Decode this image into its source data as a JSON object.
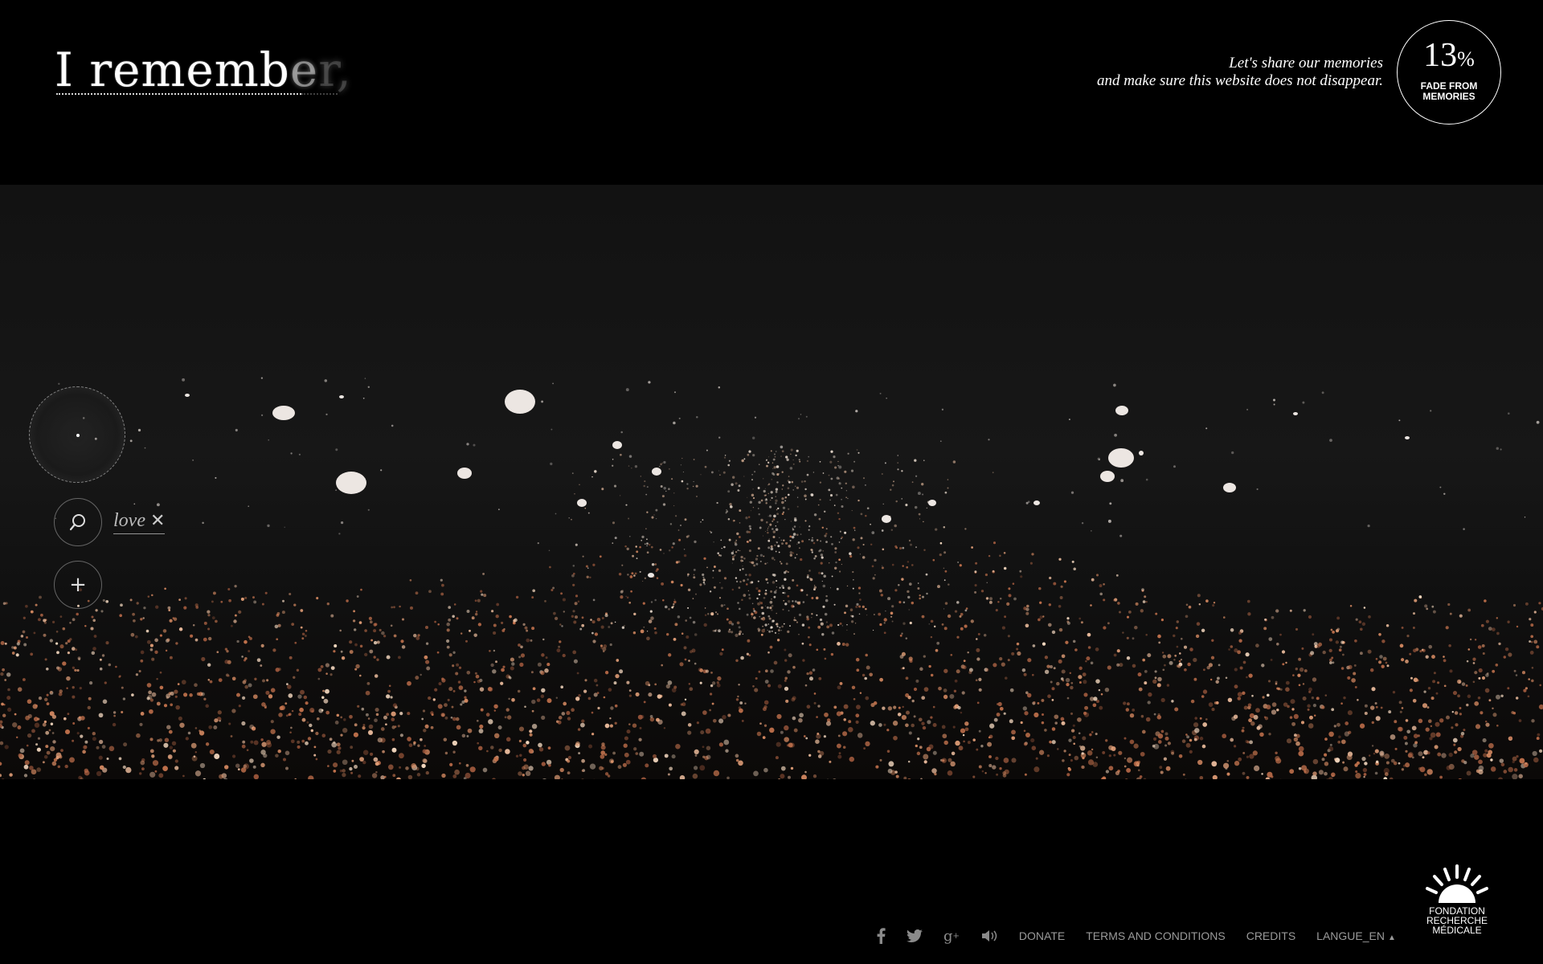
{
  "header": {
    "logo_main": "I rememb",
    "logo_fade1": "e",
    "logo_fade2": "r,",
    "tagline_line1": "Let's share our memories",
    "tagline_line2": "and make sure this website does not disappear.",
    "fade_percent": "13",
    "fade_percent_sign": "%",
    "fade_label_line1": "FADE FROM",
    "fade_label_line2": "MEMORIES"
  },
  "sidebar": {
    "search_term": "love",
    "add_label": "+"
  },
  "footer": {
    "links": [
      "DONATE",
      "TERMS AND CONDITIONS",
      "CREDITS",
      "LANGUE_EN"
    ],
    "icons": [
      "facebook-icon",
      "twitter-icon",
      "google-plus-icon",
      "sound-icon"
    ]
  },
  "brand": {
    "name_line1": "FONDATION",
    "name_line2": "RECHERCHE",
    "name_line3": "MÉDICALE"
  },
  "colors": {
    "background": "#000000",
    "text": "#ffffff",
    "particle_warm": "#e8a07a",
    "footer_text": "#9a9a9a"
  }
}
